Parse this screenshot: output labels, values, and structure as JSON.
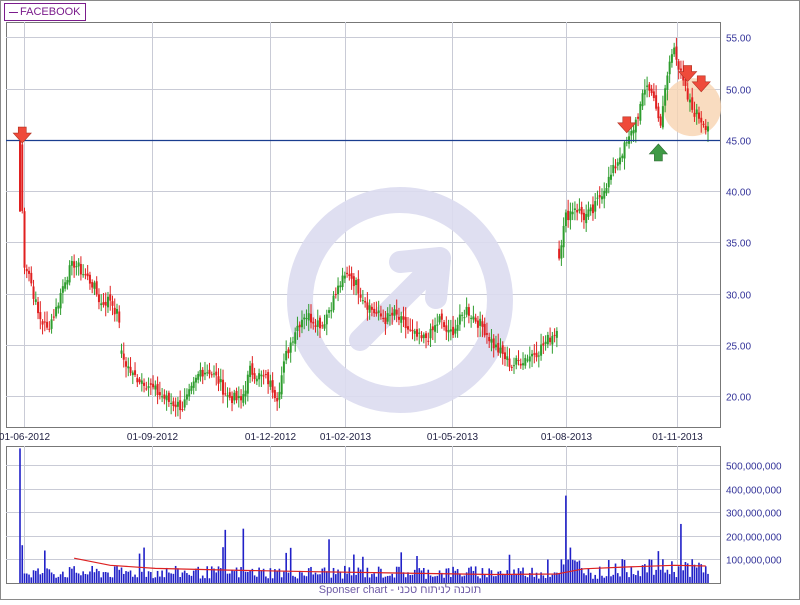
{
  "legend": {
    "symbol": "FACEBOOK"
  },
  "footer": {
    "text": "Sponser chart - תוכנה לניתוח טכני"
  },
  "colors": {
    "up": "#2e9d2e",
    "down": "#e02020",
    "grid": "#c9cbd6",
    "axis_text": "#333399",
    "support_line": "#1a3d8f",
    "volume_bar": "#2020c8",
    "volume_ma": "#dd2222",
    "arrow_down": "#ef4a3a",
    "arrow_up": "#3f9a45",
    "watermark": "#dcdcf0",
    "highlight": "#f7d3b0"
  },
  "chart_data": [
    {
      "type": "candlestick",
      "title": "FACEBOOK",
      "x_labels": [
        "01-06-2012",
        "01-09-2012",
        "01-12-2012",
        "01-02-2013",
        "01-05-2013",
        "01-08-2013",
        "01-11-2013"
      ],
      "y_ticks": [
        "55.00",
        "50.00",
        "45.00",
        "40.00",
        "35.00",
        "30.00",
        "25.00",
        "20.00"
      ],
      "ylim": [
        17,
        56.5
      ],
      "grid": true,
      "horizontal_line": 45,
      "price_path": [
        [
          0,
          44.5
        ],
        [
          1,
          38
        ],
        [
          2,
          33
        ],
        [
          4,
          32
        ],
        [
          8,
          28
        ],
        [
          12,
          26.5
        ],
        [
          16,
          28.5
        ],
        [
          20,
          31.5
        ],
        [
          24,
          33
        ],
        [
          28,
          32
        ],
        [
          32,
          31
        ],
        [
          36,
          29
        ],
        [
          40,
          29.5
        ],
        [
          44,
          27.5
        ],
        [
          45,
          24
        ],
        [
          50,
          22
        ],
        [
          55,
          21.5
        ],
        [
          60,
          20.5
        ],
        [
          66,
          19.5
        ],
        [
          72,
          19
        ],
        [
          76,
          20.5
        ],
        [
          80,
          22.5
        ],
        [
          84,
          22.5
        ],
        [
          88,
          21.5
        ],
        [
          92,
          20
        ],
        [
          98,
          19.5
        ],
        [
          102,
          22.5
        ],
        [
          106,
          22
        ],
        [
          110,
          21.5
        ],
        [
          114,
          20
        ],
        [
          118,
          24
        ],
        [
          122,
          26.5
        ],
        [
          126,
          28
        ],
        [
          130,
          27.5
        ],
        [
          134,
          27
        ],
        [
          138,
          29
        ],
        [
          142,
          31
        ],
        [
          146,
          32
        ],
        [
          150,
          30.5
        ],
        [
          154,
          29
        ],
        [
          158,
          28
        ],
        [
          162,
          27.5
        ],
        [
          166,
          28
        ],
        [
          170,
          27
        ],
        [
          174,
          26
        ],
        [
          178,
          25.5
        ],
        [
          182,
          26
        ],
        [
          186,
          27.5
        ],
        [
          190,
          26
        ],
        [
          194,
          27
        ],
        [
          198,
          28.5
        ],
        [
          202,
          27.5
        ],
        [
          206,
          26.5
        ],
        [
          210,
          25
        ],
        [
          214,
          24
        ],
        [
          218,
          23
        ],
        [
          222,
          23.5
        ],
        [
          226,
          24
        ],
        [
          230,
          24.5
        ],
        [
          234,
          25.5
        ],
        [
          238,
          26.5
        ],
        [
          239,
          34
        ],
        [
          242,
          37.5
        ],
        [
          246,
          38.5
        ],
        [
          250,
          37.5
        ],
        [
          254,
          38
        ],
        [
          258,
          40
        ],
        [
          262,
          41.5
        ],
        [
          266,
          43.5
        ],
        [
          270,
          45
        ],
        [
          274,
          47.5
        ],
        [
          278,
          50.5
        ],
        [
          282,
          48.5
        ],
        [
          284,
          46
        ],
        [
          286,
          50
        ],
        [
          288,
          52.5
        ],
        [
          290,
          54.5
        ],
        [
          292,
          52
        ],
        [
          294,
          50.5
        ],
        [
          296,
          49
        ],
        [
          298,
          48
        ],
        [
          300,
          47.5
        ],
        [
          302,
          47
        ],
        [
          304,
          46.5
        ]
      ],
      "arrows": [
        {
          "direction": "down",
          "bar": 1,
          "price": 44.5
        },
        {
          "direction": "down",
          "bar": 269,
          "price": 45.5
        },
        {
          "direction": "up",
          "bar": 283,
          "price": 45
        },
        {
          "direction": "down",
          "bar": 296,
          "price": 50.5
        },
        {
          "direction": "down",
          "bar": 302,
          "price": 49.5
        }
      ],
      "highlight": {
        "bar": 298,
        "price": 48.2
      }
    },
    {
      "type": "bar",
      "title": "Volume",
      "y_ticks": [
        "500,000,000",
        "400,000,000",
        "300,000,000",
        "200,000,000",
        "100,000,000"
      ],
      "ylim": [
        0,
        580000000
      ],
      "volume_spikes": [
        {
          "bar": 0,
          "value": 570000000
        },
        {
          "bar": 1,
          "value": 160000000
        },
        {
          "bar": 55,
          "value": 150000000
        },
        {
          "bar": 91,
          "value": 225000000
        },
        {
          "bar": 99,
          "value": 230000000
        },
        {
          "bar": 137,
          "value": 185000000
        },
        {
          "bar": 242,
          "value": 370000000
        },
        {
          "bar": 244,
          "value": 150000000
        },
        {
          "bar": 283,
          "value": 135000000
        },
        {
          "bar": 293,
          "value": 250000000
        }
      ],
      "baseline_volume": 50000000,
      "moving_average": [
        [
          24,
          105000000
        ],
        [
          40,
          75000000
        ],
        [
          60,
          62000000
        ],
        [
          90,
          55000000
        ],
        [
          130,
          48000000
        ],
        [
          170,
          42000000
        ],
        [
          210,
          36000000
        ],
        [
          238,
          38000000
        ],
        [
          250,
          60000000
        ],
        [
          270,
          68000000
        ],
        [
          290,
          75000000
        ],
        [
          304,
          72000000
        ]
      ]
    }
  ]
}
